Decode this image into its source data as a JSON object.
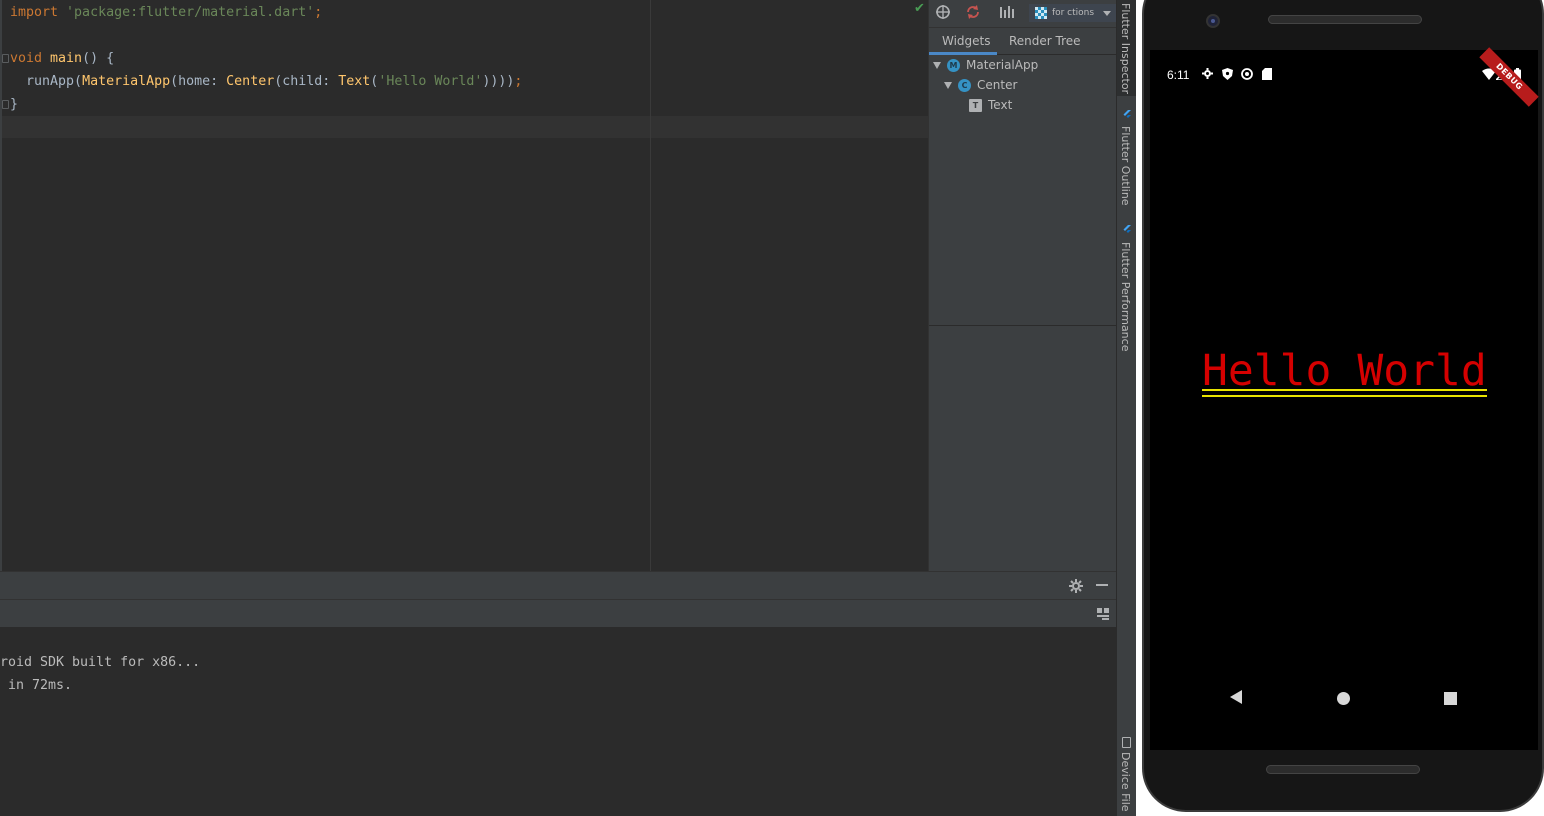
{
  "editor": {
    "lines": [
      {
        "segments": [
          {
            "t": "import ",
            "c": "kw"
          },
          {
            "t": "'package:flutter/material.dart'",
            "c": "str"
          },
          {
            "t": ";",
            "c": "kw"
          }
        ]
      },
      {
        "segments": [
          {
            "t": "void ",
            "c": "kw"
          },
          {
            "t": "main",
            "c": "fn"
          },
          {
            "t": "() {",
            "c": ""
          }
        ]
      },
      {
        "segments": [
          {
            "t": "  runApp(",
            "c": ""
          },
          {
            "t": "MaterialApp",
            "c": "fn"
          },
          {
            "t": "(home: ",
            "c": ""
          },
          {
            "t": "Center",
            "c": "fn"
          },
          {
            "t": "(child: ",
            "c": ""
          },
          {
            "t": "Text",
            "c": "fn"
          },
          {
            "t": "(",
            "c": ""
          },
          {
            "t": "'Hello World'",
            "c": "str"
          },
          {
            "t": "))))",
            "c": ""
          },
          {
            "t": ";",
            "c": "kw"
          }
        ]
      },
      {
        "segments": [
          {
            "t": "}",
            "c": ""
          }
        ]
      }
    ]
  },
  "inspector": {
    "toolbar_label": "for ctions",
    "tabs": [
      "Widgets",
      "Render Tree"
    ],
    "tree": [
      {
        "label": "MaterialApp",
        "icon": "M"
      },
      {
        "label": "Center",
        "icon": "C"
      },
      {
        "label": "Text",
        "icon": "T"
      }
    ]
  },
  "side_tabs": {
    "inspector": "Flutter Inspector",
    "outline": "Flutter Outline",
    "performance": "Flutter Performance",
    "device_file": "Device File E"
  },
  "console": {
    "lines": [
      "roid SDK built for x86...",
      " in 72ms."
    ]
  },
  "device": {
    "time": "6:11",
    "debug_banner": "DEBUG",
    "hello_text": "Hello World"
  },
  "colors": {
    "keyword": "#cc7832",
    "function": "#ffc66d",
    "string": "#6a8759",
    "hello_text": "#d50000",
    "underline": "#e8e300"
  }
}
